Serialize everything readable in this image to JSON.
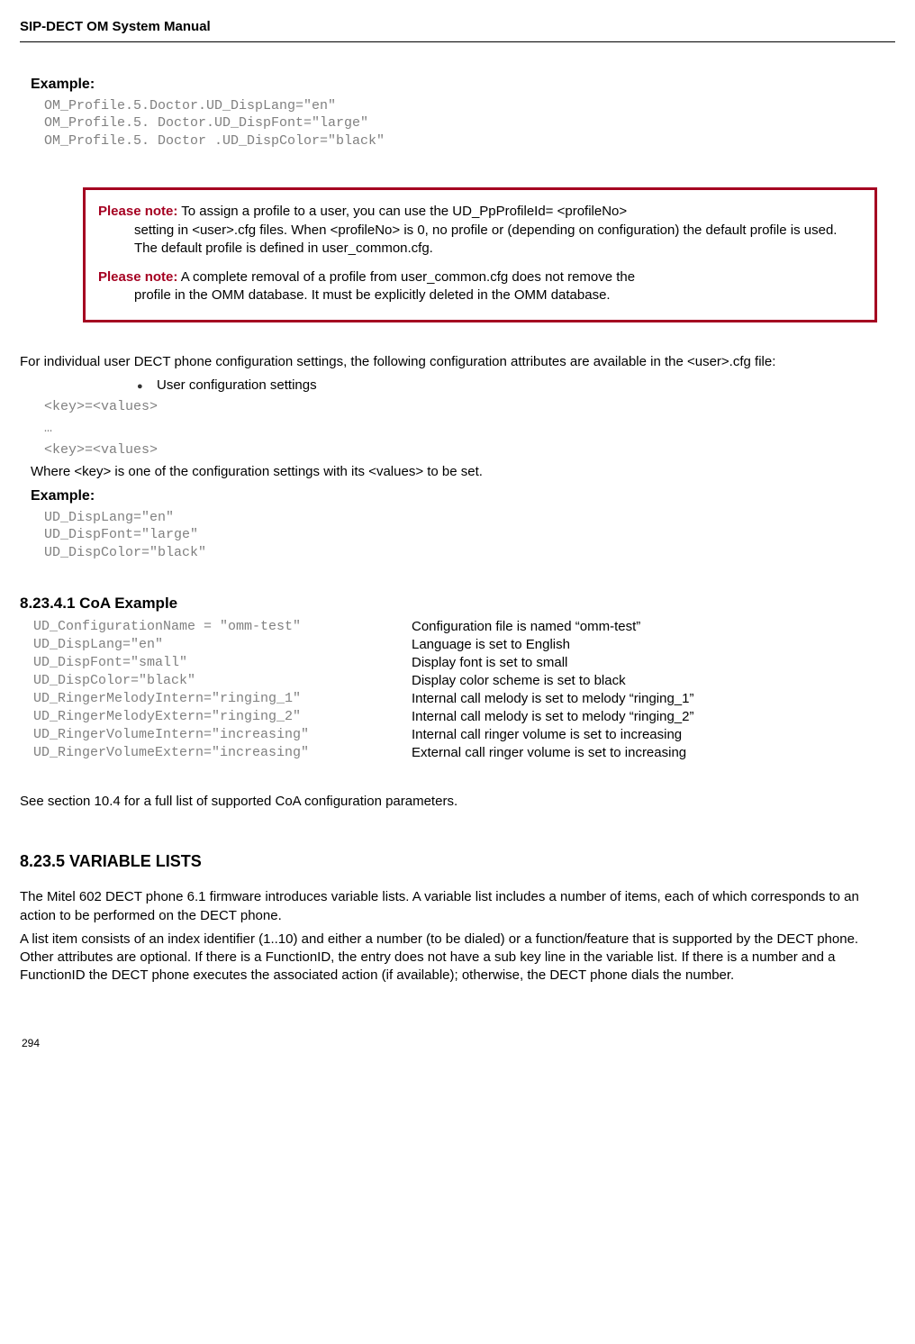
{
  "header": {
    "title": "SIP-DECT OM System Manual"
  },
  "example1": {
    "label": "Example:",
    "code": "OM_Profile.5.Doctor.UD_DispLang=\"en\"\nOM_Profile.5. Doctor.UD_DispFont=\"large\"\nOM_Profile.5. Doctor .UD_DispColor=\"black\""
  },
  "notes": {
    "note1_label": "Please note:",
    "note1_lead": "  To assign a profile to a user, you can use the UD_PpProfileId= <profileNo>",
    "note1_rest": "setting in <user>.cfg files. When <profileNo> is 0, no profile or (depending on configuration) the default profile is used. The default profile is defined in user_common.cfg.",
    "note2_label": "Please note:",
    "note2_lead": "  A complete removal of a profile from user_common.cfg does not remove the",
    "note2_rest": "profile in the OMM database. It must be explicitly deleted in the OMM database."
  },
  "body": {
    "intro": "For individual user DECT phone configuration settings, the following configuration attributes are available in the <user>.cfg file:",
    "bullet": "User configuration settings",
    "kv_block": "<key>=<values>\n…\n<key>=<values>",
    "where_line": "Where <key> is one of the configuration settings with its <values> to be set."
  },
  "example2": {
    "label": "Example:",
    "code": "UD_DispLang=\"en\"\nUD_DispFont=\"large\"\nUD_DispColor=\"black\""
  },
  "coa": {
    "heading": "8.23.4.1     CoA Example",
    "code": "UD_ConfigurationName = \"omm-test\"\nUD_DispLang=\"en\"\nUD_DispFont=\"small\"\nUD_DispColor=\"black\"\nUD_RingerMelodyIntern=\"ringing_1\"\nUD_RingerMelodyExtern=\"ringing_2\"\nUD_RingerVolumeIntern=\"increasing\"\nUD_RingerVolumeExtern=\"increasing\"",
    "desc": "Configuration file is named “omm-test”\nLanguage is set to English\nDisplay font is set to small\nDisplay color scheme is set to black\nInternal call melody is set to melody “ringing_1”\nInternal call melody is set to melody “ringing_2”\nInternal call ringer volume is set to increasing\nExternal call ringer volume is set to increasing"
  },
  "see_section": "See section 10.4 for a full list of supported CoA configuration parameters.",
  "varlists": {
    "heading": "8.23.5 VARIABLE LISTS",
    "p1": "The Mitel 602 DECT phone 6.1 firmware introduces variable lists. A variable list includes a number of items, each of which corresponds to an action to be performed on the DECT phone.",
    "p2": "A list item consists of an index identifier (1..10) and either a number (to be dialed) or a function/feature that is supported by the DECT phone. Other attributes are optional. If there is a FunctionID, the entry does not have a sub key line in the variable list. If there is a number and a FunctionID the DECT phone executes the associated action (if available); otherwise, the DECT phone dials the number."
  },
  "page_number": "294"
}
